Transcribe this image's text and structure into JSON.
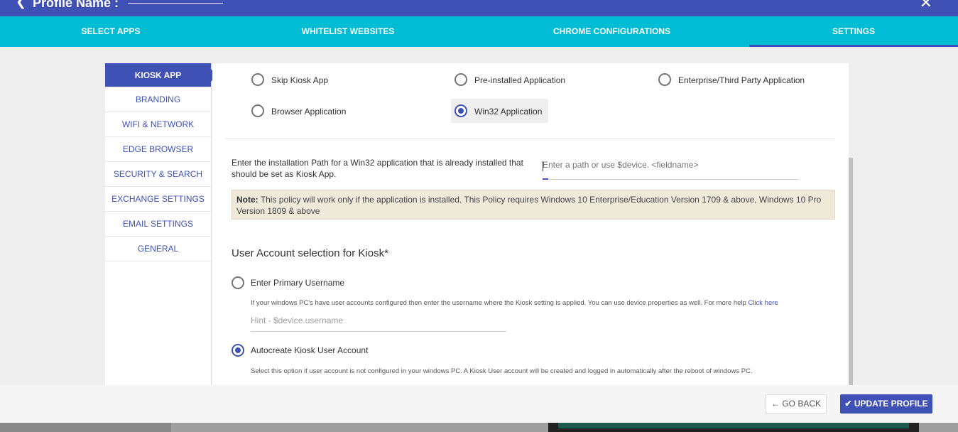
{
  "header": {
    "back_icon": "back-arrow-icon",
    "profile_label": "Profile Name :",
    "close_icon": "close-icon"
  },
  "tabs": [
    {
      "label": "SELECT APPS"
    },
    {
      "label": "WHITELIST WEBSITES"
    },
    {
      "label": "CHROME CONFIGURATIONS"
    },
    {
      "label": "SETTINGS"
    }
  ],
  "sidebar": {
    "items": [
      {
        "label": "KIOSK APP"
      },
      {
        "label": "BRANDING"
      },
      {
        "label": "WIFI & NETWORK"
      },
      {
        "label": "EDGE BROWSER"
      },
      {
        "label": "SECURITY & SEARCH"
      },
      {
        "label": "EXCHANGE SETTINGS"
      },
      {
        "label": "EMAIL SETTINGS"
      },
      {
        "label": "GENERAL"
      }
    ]
  },
  "kiosk": {
    "options": [
      {
        "label": "Skip Kiosk App",
        "checked": false
      },
      {
        "label": "Pre-installed Application",
        "checked": false
      },
      {
        "label": "Enterprise/Third Party Application",
        "checked": false
      },
      {
        "label": "Browser Application",
        "checked": false
      },
      {
        "label": "Win32 Application",
        "checked": true
      }
    ],
    "install_text": "Enter the installation Path for a Win32 application that is already installed that should be set as Kiosk App.",
    "path_placeholder": "Enter a path or use $device. <fieldname>",
    "note_label": "Note:",
    "note_text": "This policy will work only if the application is installed. This Policy requires Windows 10 Enterprise/Education Version 1709 & above, Windows 10 Pro Version 1809 & above"
  },
  "account": {
    "title": "User Account selection for Kiosk*",
    "primary_label": "Enter Primary Username",
    "primary_help": "If your windows PC's have user accounts configured then enter the username where the Kiosk setting is applied. You can use device properties as well. For more help",
    "help_link": "Click here",
    "hint_placeholder": "Hint - $device.username",
    "autocreate_label": "Autocreate Kiosk User Account",
    "autocreate_help": "Select this option if user account is not configured in your windows PC. A Kiosk User account will be created and logged in automatically after the reboot of windows PC."
  },
  "footer": {
    "back_label": "GO BACK",
    "update_label": "UPDATE PROFILE"
  },
  "colors": {
    "primary": "#3f51b5",
    "tabs_bg": "#00bcd4",
    "note_bg": "#efe9da"
  }
}
